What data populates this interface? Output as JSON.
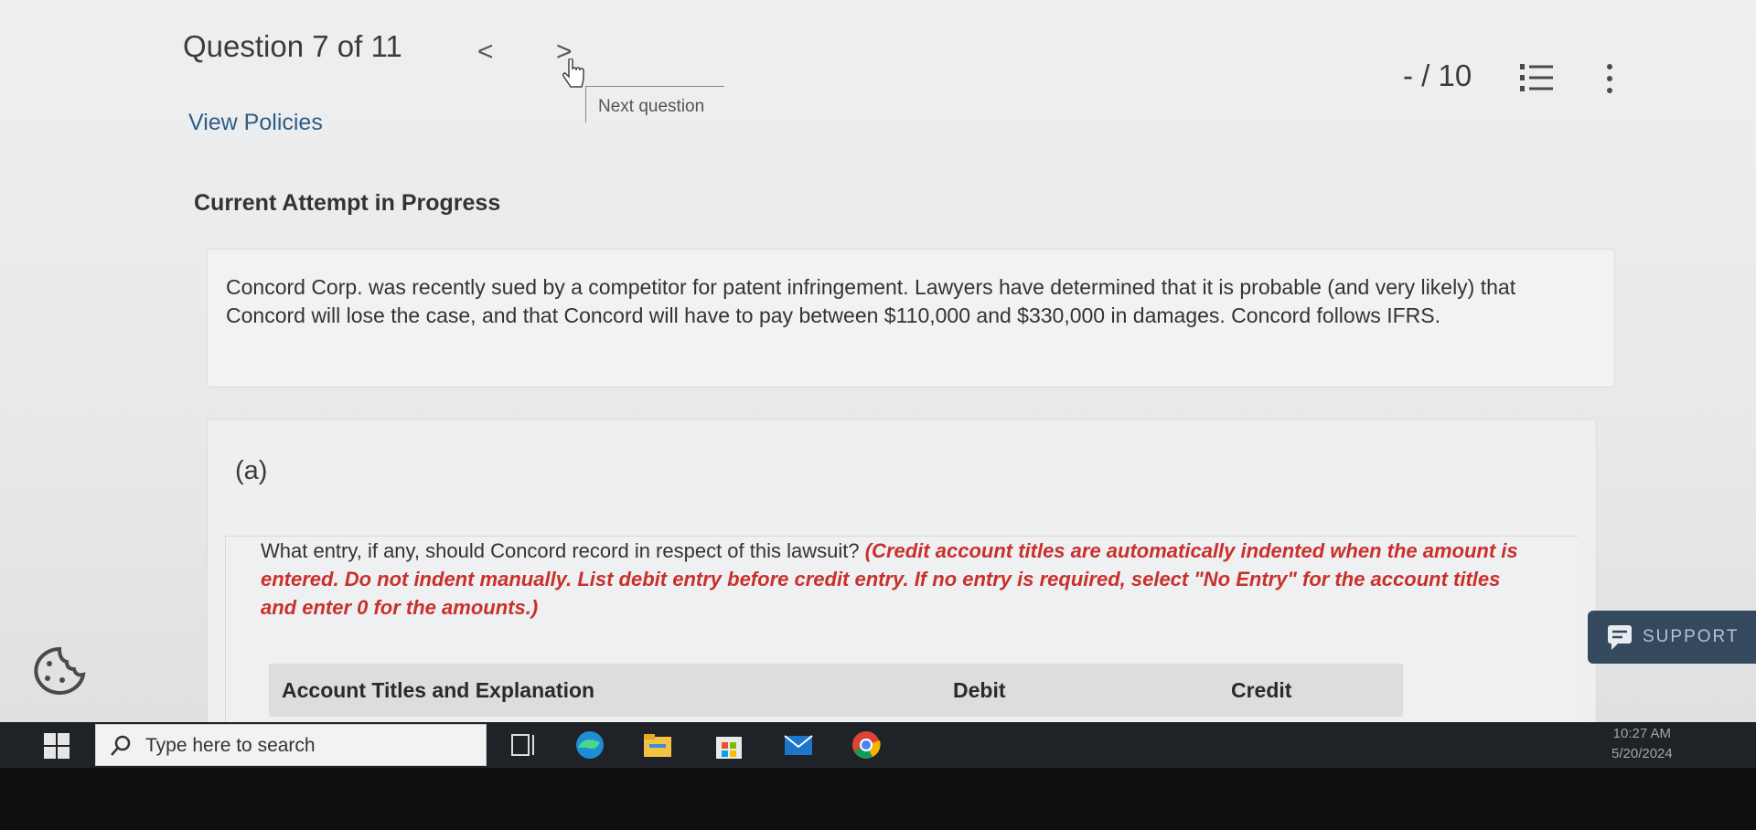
{
  "header": {
    "question_counter": "Question 7 of 11",
    "prev_symbol": "<",
    "next_symbol": ">",
    "next_tooltip": "Next question",
    "view_policies": "View Policies",
    "score": "- / 10"
  },
  "attempt_title": "Current Attempt in Progress",
  "question": {
    "text": "Concord Corp. was recently sued by a competitor for patent infringement. Lawyers have determined that it is probable (and very likely) that Concord will lose the case, and that Concord will have to pay between $110,000 and $330,000 in damages. Concord follows IFRS."
  },
  "part": {
    "label": "(a)",
    "instruction": "What entry, if any, should Concord record in respect of this lawsuit?",
    "instruction_note": "(Credit account titles are automatically indented when the amount is entered. Do not indent manually. List debit entry before credit entry. If no entry is required, select \"No Entry\" for the account titles and enter 0 for the amounts.)"
  },
  "table": {
    "columns": [
      "Account Titles and Explanation",
      "Debit",
      "Credit"
    ]
  },
  "support_label": "SUPPORT",
  "taskbar": {
    "search_placeholder": "Type here to search",
    "time": "10:27 AM",
    "date": "5/20/2024"
  },
  "colors": {
    "accent_red": "#c9302c",
    "link_blue": "#2e5d86",
    "support_bg": "#35495e"
  },
  "icons": [
    "hand-pointer-icon",
    "numbered-list-icon",
    "more-vertical-icon",
    "support-chat-icon",
    "cookie-icon",
    "windows-start-icon",
    "search-icon",
    "task-view-icon",
    "edge-icon",
    "file-explorer-icon",
    "store-icon",
    "mail-icon",
    "chrome-icon"
  ]
}
